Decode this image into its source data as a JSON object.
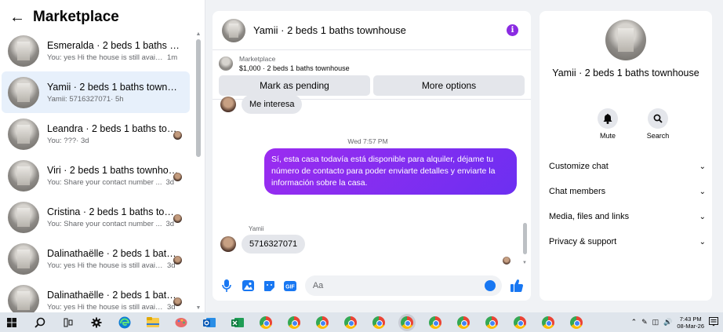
{
  "sidebar": {
    "title": "Marketplace",
    "conversations": [
      {
        "name": "Esmeralda · 2 beds 1 baths town...",
        "preview": "You: yes Hi the house is still availa...",
        "time": "1m",
        "active": false,
        "seen": false
      },
      {
        "name": "Yamii · 2 beds 1 baths townhouse",
        "preview": "Yamii: 5716327071",
        "time": "· 5h",
        "active": true,
        "seen": false
      },
      {
        "name": "Leandra · 2 beds 1 baths town...",
        "preview": "You: ???",
        "time": "· 3d",
        "active": false,
        "seen": true
      },
      {
        "name": "Viri · 2 beds 1 baths townhouse",
        "preview": "You: Share your contact number ...",
        "time": "3d",
        "active": false,
        "seen": true
      },
      {
        "name": "Cristina · 2 beds 1 baths town...",
        "preview": "You: Share your contact number ...",
        "time": "3d",
        "active": false,
        "seen": true
      },
      {
        "name": "Dalinathaëlle · 2 beds 1 baths ...",
        "preview": "You: yes Hi the house is still availa...",
        "time": "3d",
        "active": false,
        "seen": true
      },
      {
        "name": "Dalinathaëlle · 2 beds 1 baths ...",
        "preview": "You: yes Hi the house is still avail...",
        "time": "3d",
        "active": false,
        "seen": true
      }
    ]
  },
  "chat": {
    "title": "Yamii · 2 beds 1 baths townhouse",
    "marketplace_label": "Marketplace",
    "listing": "$1,000 · 2 beds 1 baths townhouse",
    "mark_pending": "Mark as pending",
    "more_options": "More options",
    "incoming_1": "Me interesa",
    "timestamp": "Wed 7:57 PM",
    "outgoing_1": "Sí, esta casa todavía está disponible para alquiler, déjame tu número de contacto para poder enviarte detalles y enviarte la información sobre la casa.",
    "sender": "Yamii",
    "incoming_2": "5716327071",
    "composer_placeholder": "Aa"
  },
  "details": {
    "title": "Yamii · 2 beds 1 baths townhouse",
    "mute": "Mute",
    "search": "Search",
    "menu": [
      "Customize chat",
      "Chat members",
      "Media, files and links",
      "Privacy & support"
    ]
  },
  "taskbar": {
    "time": "7:43 PM",
    "date": "08-Mar-26"
  },
  "colors": {
    "accent": "#8a2be2",
    "bubble_gradient_start": "#9b2cf0",
    "bubble_gradient_end": "#6c2ff1",
    "icon_blue": "#1877f2"
  }
}
